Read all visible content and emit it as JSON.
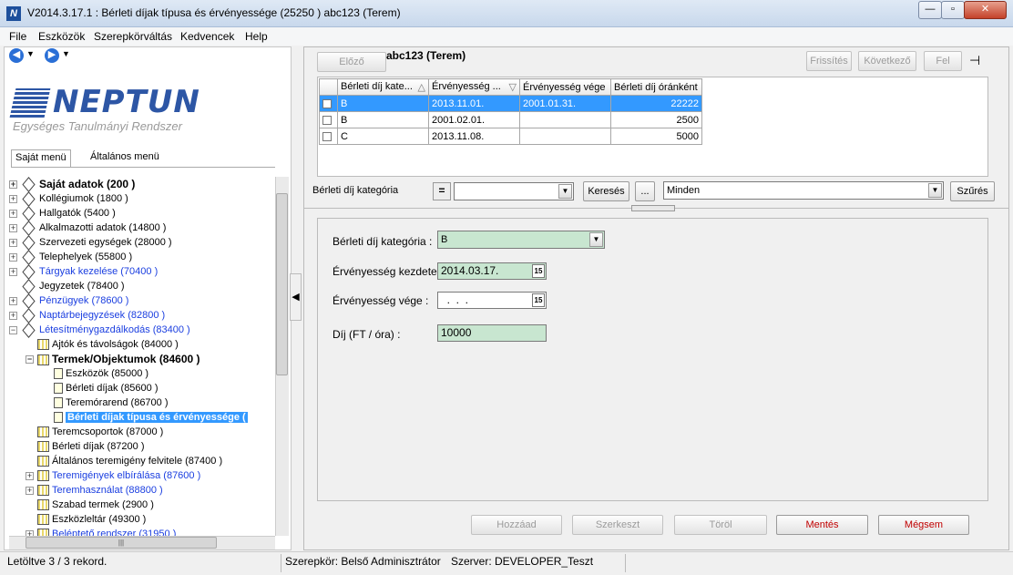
{
  "window": {
    "title": "V2014.3.17.1 : Bérleti díjak típusa és érvényessége (25250  ) abc123 (Terem)",
    "app_icon": "N"
  },
  "menu": [
    "File",
    "Eszközök",
    "Szerepkörváltás",
    "Kedvencek",
    "Help"
  ],
  "logo": {
    "name": "NEPTUN",
    "subtitle": "Egységes Tanulmányi Rendszer"
  },
  "menu_tabs": {
    "own": "Saját menü",
    "general": "Általános menü"
  },
  "tree": [
    {
      "label": "Saját adatok (200  )",
      "style": "bold",
      "icon": "diamond",
      "exp": "+"
    },
    {
      "label": "Kollégiumok (1800  )",
      "icon": "diamond",
      "exp": "+"
    },
    {
      "label": "Hallgatók (5400  )",
      "icon": "diamond",
      "exp": "+"
    },
    {
      "label": "Alkalmazotti adatok (14800  )",
      "icon": "diamond",
      "exp": "+"
    },
    {
      "label": "Szervezeti egységek (28000  )",
      "icon": "diamond",
      "exp": "+"
    },
    {
      "label": "Telephelyek (55800  )",
      "icon": "diamond",
      "exp": "+"
    },
    {
      "label": "Tárgyak kezelése (70400  )",
      "style": "blue",
      "icon": "diamond",
      "exp": "+"
    },
    {
      "label": "Jegyzetek (78400  )",
      "icon": "diamond",
      "exp": ""
    },
    {
      "label": "Pénzügyek (78600  )",
      "style": "blue",
      "icon": "diamond",
      "exp": "+"
    },
    {
      "label": "Naptárbejegyzések (82800  )",
      "style": "blue",
      "icon": "diamond",
      "exp": "+"
    },
    {
      "label": "Létesítménygazdálkodás (83400  )",
      "style": "blue",
      "icon": "diamond",
      "exp": "−"
    },
    {
      "label": "Ajtók és távolságok (84000  )",
      "icon": "folder",
      "exp": "",
      "indent": 1
    },
    {
      "label": "Termek/Objektumok (84600  )",
      "style": "bold",
      "icon": "folder",
      "exp": "−",
      "indent": 1
    },
    {
      "label": "Eszközök (85000  )",
      "icon": "doc",
      "exp": "",
      "indent": 2
    },
    {
      "label": "Bérleti díjak (85600  )",
      "icon": "doc",
      "exp": "",
      "indent": 2
    },
    {
      "label": "Teremórarend (86700  )",
      "icon": "doc",
      "exp": "",
      "indent": 2
    },
    {
      "label": "Bérleti díjak típusa és érvényessége (",
      "style": "sel",
      "icon": "doc",
      "exp": "",
      "indent": 2
    },
    {
      "label": "Teremcsoportok (87000  )",
      "icon": "folder",
      "exp": "",
      "indent": 1
    },
    {
      "label": "Bérleti díjak (87200  )",
      "icon": "folder",
      "exp": "",
      "indent": 1
    },
    {
      "label": "Általános teremigény felvitele (87400  )",
      "icon": "folder",
      "exp": "",
      "indent": 1
    },
    {
      "label": "Teremigények elbírálása (87600  )",
      "style": "blue",
      "icon": "folder",
      "exp": "+",
      "indent": 1
    },
    {
      "label": "Teremhasználat (88800  )",
      "style": "blue",
      "icon": "folder",
      "exp": "+",
      "indent": 1
    },
    {
      "label": "Szabad termek (2900  )",
      "icon": "folder",
      "exp": "",
      "indent": 1
    },
    {
      "label": "Eszközleltár (49300  )",
      "icon": "folder",
      "exp": "",
      "indent": 1
    },
    {
      "label": "Beléptető rendszer (31950  )",
      "style": "blue",
      "icon": "folder",
      "exp": "+",
      "indent": 1
    }
  ],
  "toolbar": {
    "prev": "Előző",
    "record_title": "abc123 (Terem)",
    "refresh": "Frissítés",
    "next": "Következő",
    "up": "Fel"
  },
  "grid": {
    "headers": [
      "Bérleti díj kate...",
      "Érvényesség ...",
      "Érvényesség vége",
      "Bérleti díj óránként"
    ],
    "rows": [
      {
        "cat": "B",
        "start": "2013.11.01.",
        "end": "2001.01.31.",
        "fee": "22222",
        "selected": true
      },
      {
        "cat": "B",
        "start": "2001.02.01.",
        "end": "",
        "fee": "2500",
        "selected": false
      },
      {
        "cat": "C",
        "start": "2013.11.08.",
        "end": "",
        "fee": "5000",
        "selected": false
      }
    ]
  },
  "filter": {
    "label": "Bérleti díj kategória",
    "operator": "=",
    "value": "",
    "search": "Keresés",
    "ellipsis": "...",
    "scope": "Minden",
    "apply": "Szűrés"
  },
  "form": {
    "cat_label": "Bérleti díj kategória :",
    "cat_value": "B",
    "start_label": "Érvényesség kezdete :",
    "start_value": "2014.03.17.",
    "end_label": "Érvényesség vége :",
    "end_value": "  .  .  .",
    "fee_label": "Díj  (FT / óra) :",
    "fee_value": "10000",
    "cal_glyph": "15"
  },
  "actions": {
    "add": "Hozzáad",
    "edit": "Szerkeszt",
    "delete": "Töröl",
    "save": "Mentés",
    "cancel": "Mégsem"
  },
  "status": {
    "records": "Letöltve 3 / 3 rekord.",
    "role": "Szerepkör: Belső Adminisztrátor",
    "server": "Szerver: DEVELOPER_Teszt"
  }
}
